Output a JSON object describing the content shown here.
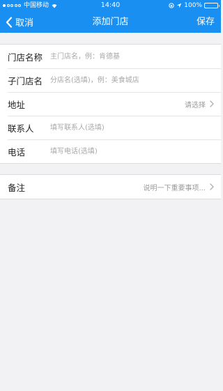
{
  "status_bar": {
    "carrier": "中国移动",
    "time": "14:40",
    "battery": "100%"
  },
  "navbar": {
    "back_label": "取消",
    "title": "添加门店",
    "save_label": "保存"
  },
  "form": {
    "store_name": {
      "label": "门店名称",
      "placeholder": "主门店名，例：肯德基"
    },
    "sub_store_name": {
      "label": "子门店名",
      "placeholder": "分店名(选填)，例：美食城店"
    },
    "address": {
      "label": "地址",
      "value": "请选择"
    },
    "contact": {
      "label": "联系人",
      "placeholder": "填写联系人(选填)"
    },
    "phone": {
      "label": "电话",
      "placeholder": "填写电话(选填)"
    }
  },
  "notes": {
    "label": "备注",
    "value": "说明一下重要事项..."
  },
  "colors": {
    "accent": "#1a8ff2",
    "background": "#f2f2f4"
  }
}
